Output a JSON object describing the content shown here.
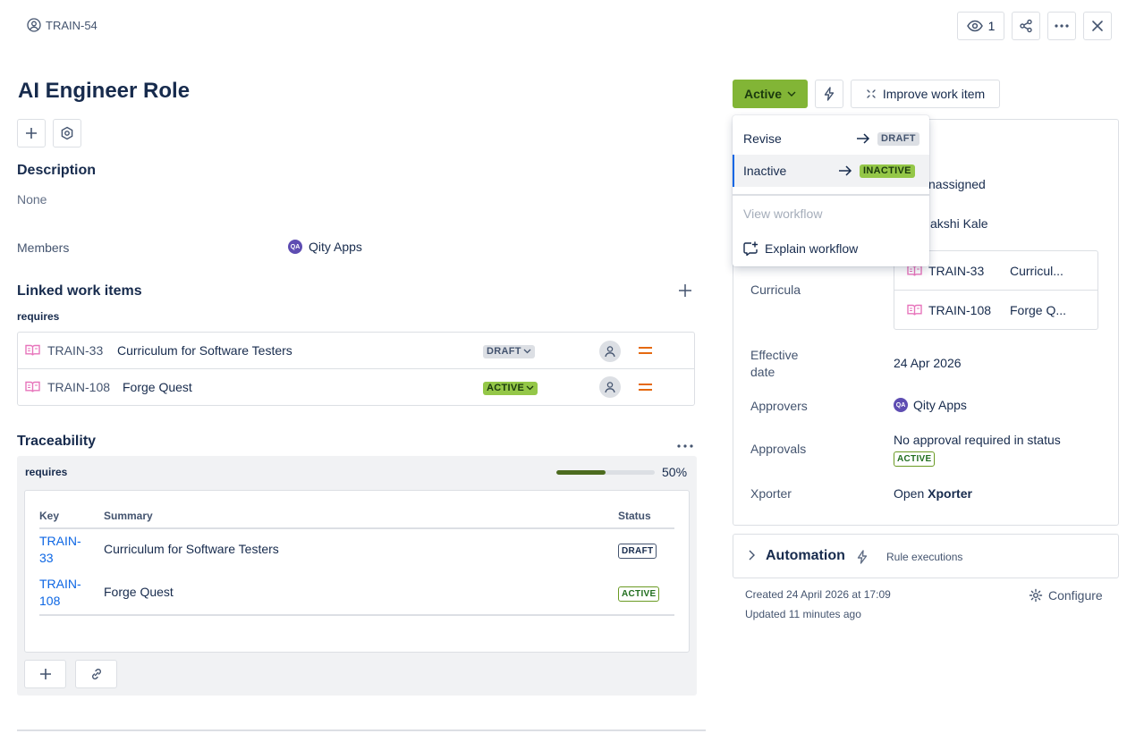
{
  "header": {
    "issue_key": "TRAIN-54",
    "watch_count": "1"
  },
  "issue": {
    "title": "AI Engineer Role"
  },
  "description": {
    "heading": "Description",
    "value": "None"
  },
  "members": {
    "label": "Members",
    "avatar_initials": "QA",
    "value": "Qity Apps"
  },
  "linked": {
    "heading": "Linked work items",
    "relation": "requires",
    "items": [
      {
        "key": "TRAIN-33",
        "summary": "Curriculum for Software Testers",
        "status": "DRAFT"
      },
      {
        "key": "TRAIN-108",
        "summary": "Forge Quest",
        "status": "ACTIVE"
      }
    ]
  },
  "traceability": {
    "heading": "Traceability",
    "relation": "requires",
    "progress": 50,
    "progress_label": "50%",
    "columns": [
      "Key",
      "Summary",
      "Status"
    ],
    "rows": [
      {
        "key_line1": "TRAIN-",
        "key_line2": "33",
        "summary": "Curriculum for Software Testers",
        "status": "DRAFT"
      },
      {
        "key_line1": "TRAIN-",
        "key_line2": "108",
        "summary": "Forge Quest",
        "status": "ACTIVE"
      }
    ]
  },
  "status_bar": {
    "status_button": "Active",
    "improve_label": "Improve work item"
  },
  "dropdown": {
    "transitions": [
      {
        "label": "Revise",
        "target": "DRAFT"
      },
      {
        "label": "Inactive",
        "target": "INACTIVE"
      }
    ],
    "view_workflow": "View workflow",
    "explain_workflow": "Explain workflow"
  },
  "details": {
    "assignee_partial": "nassigned",
    "reporter_partial": "akshi Kale",
    "curricula_label": "Curricula",
    "curricula": [
      {
        "key": "TRAIN-33",
        "summary": "Curricul..."
      },
      {
        "key": "TRAIN-108",
        "summary": "Forge Q..."
      }
    ],
    "effective_label_1": "Effective",
    "effective_label_2": "date",
    "effective_value": "24 Apr 2026",
    "approvers_label": "Approvers",
    "approvers_initials": "QA",
    "approvers_value": "Qity Apps",
    "approvals_label": "Approvals",
    "approvals_value": "No approval required in status",
    "approvals_status": "ACTIVE",
    "xporter_label": "Xporter",
    "xporter_prefix": "Open",
    "xporter_bold": "Xporter"
  },
  "automation": {
    "heading": "Automation",
    "rule_executions": "Rule executions"
  },
  "footer": {
    "created": "Created 24 April 2026 at 17:09",
    "updated": "Updated 11 minutes ago",
    "configure": "Configure"
  },
  "colors": {
    "accent_green": "#82b536",
    "link_blue": "#0c66e4",
    "book_pink": "#e774bb",
    "priority_orange": "#e56910"
  }
}
